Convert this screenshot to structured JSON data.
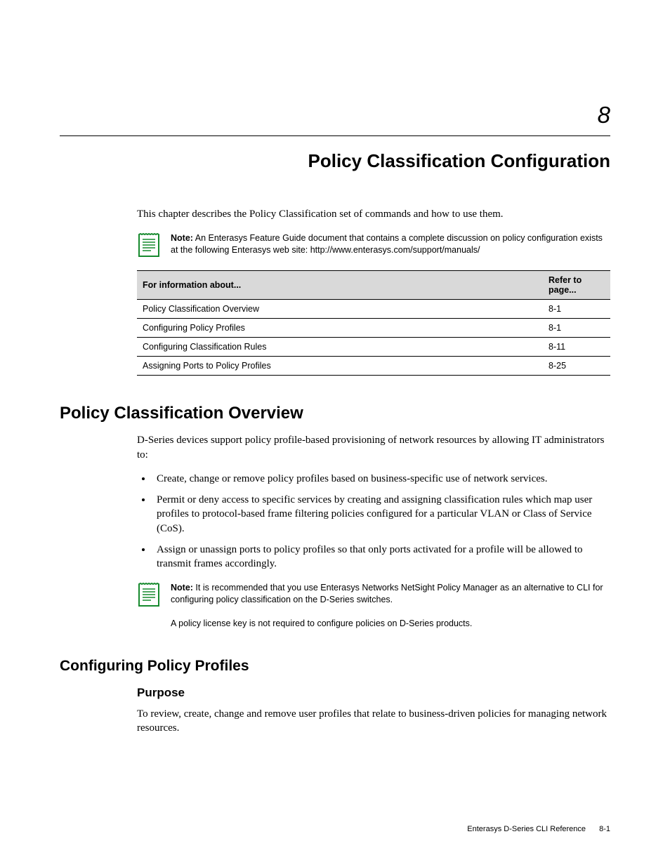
{
  "chapter": {
    "label": "8",
    "title": "Policy Classification Configuration"
  },
  "intro": "This chapter describes the Policy Classification set of commands and how to use them.",
  "note1": {
    "boldLabel": "Note:",
    "text": " An Enterasys Feature Guide document that contains a complete discussion on policy configuration exists at the following Enterasys web site: http://www.enterasys.com/support/manuals/"
  },
  "toc": {
    "headers": {
      "col1": "For information about...",
      "col2": "Refer to page..."
    },
    "rows": [
      {
        "topic": "Policy Classification Overview",
        "page": "8-1"
      },
      {
        "topic": "Configuring Policy Profiles",
        "page": "8-1"
      },
      {
        "topic": "Configuring Classification Rules",
        "page": "8-11"
      },
      {
        "topic": "Assigning Ports to Policy Profiles",
        "page": "8-25"
      }
    ]
  },
  "overview": {
    "heading": "Policy Classification Overview",
    "para": "D-Series devices support policy profile-based provisioning of network resources by allowing IT administrators to:",
    "bullets": [
      "Create, change or remove policy profiles based on business-specific use of network services.",
      "Permit or deny access to specific services by creating and assigning classification rules which map user profiles to protocol-based frame filtering policies configured for a particular VLAN or Class of Service (CoS).",
      "Assign or unassign ports to policy profiles so that only ports activated for a profile will be allowed to transmit frames accordingly."
    ]
  },
  "note2": {
    "boldLabel": "Note:",
    "line1": " It is recommended that you use Enterasys Networks NetSight Policy Manager as an alternative to CLI for configuring policy classification on the D-Series switches.",
    "line2": "A policy license key is not required to configure policies on D-Series products."
  },
  "configSection": {
    "heading": "Configuring Policy Profiles",
    "subHeading": "Purpose",
    "para": "To review, create, change and remove user profiles that relate to business-driven policies for managing network resources."
  },
  "footer": {
    "text": "Enterasys D-Series CLI Reference",
    "page": "8-1"
  },
  "iconAlt": "note-icon"
}
